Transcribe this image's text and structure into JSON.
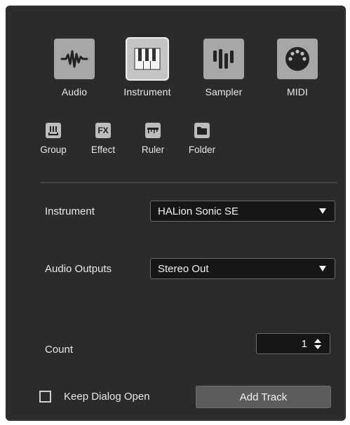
{
  "track_types": [
    {
      "label": "Audio",
      "icon": "audio-waveform-icon"
    },
    {
      "label": "Instrument",
      "icon": "piano-keys-icon",
      "selected": true
    },
    {
      "label": "Sampler",
      "icon": "sampler-bars-icon"
    },
    {
      "label": "MIDI",
      "icon": "midi-connector-icon"
    }
  ],
  "small_track_types": [
    {
      "label": "Group",
      "icon": "group-icon"
    },
    {
      "label": "Effect",
      "icon": "fx-icon",
      "glyph": "FX"
    },
    {
      "label": "Ruler",
      "icon": "ruler-icon"
    },
    {
      "label": "Folder",
      "icon": "folder-icon"
    }
  ],
  "instrument": {
    "label": "Instrument",
    "value": "HALion Sonic SE"
  },
  "audio_outputs": {
    "label": "Audio Outputs",
    "value": "Stereo Out"
  },
  "count": {
    "label": "Count",
    "value": "1"
  },
  "keep_open": {
    "label": "Keep Dialog Open",
    "checked": false
  },
  "add_track": {
    "label": "Add Track"
  }
}
